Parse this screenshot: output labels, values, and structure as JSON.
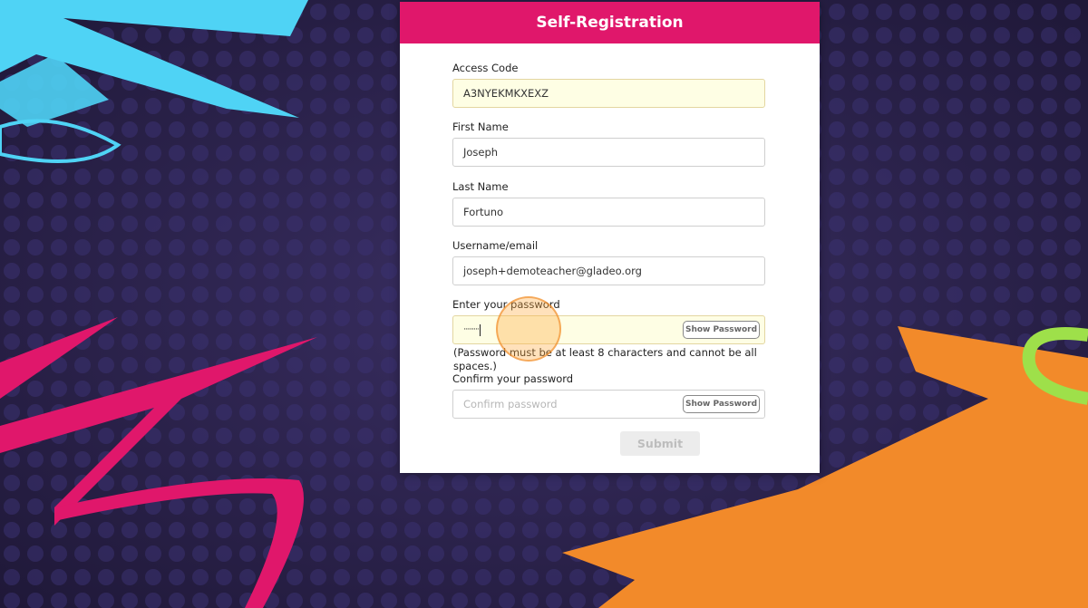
{
  "header": {
    "title": "Self-Registration"
  },
  "form": {
    "access_code": {
      "label": "Access Code",
      "value": "A3NYEKMKXEXZ"
    },
    "first_name": {
      "label": "First Name",
      "value": "Joseph"
    },
    "last_name": {
      "label": "Last Name",
      "value": "Fortuno"
    },
    "username": {
      "label": "Username/email",
      "value": "joseph+demoteacher@gladeo.org"
    },
    "password": {
      "label": "Enter your password",
      "value": "·········",
      "show_label": "Show Password"
    },
    "password_hint": "(Password must be at least 8 characters and cannot be all spaces.)",
    "confirm_password": {
      "label": "Confirm your password",
      "placeholder": "Confirm password",
      "show_label": "Show Password"
    },
    "submit_label": "Submit"
  },
  "colors": {
    "header": "#e0176b",
    "background": "#2a2246",
    "brush_cyan": "#4fd3f5",
    "brush_pink": "#e0176b",
    "brush_orange": "#f28a2a",
    "brush_lime": "#9ee04a"
  }
}
